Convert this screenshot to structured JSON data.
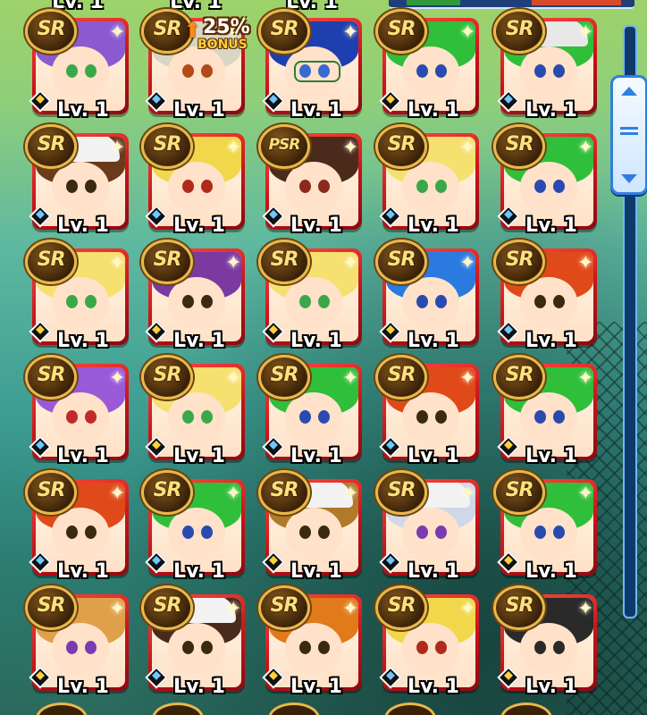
{
  "top_partial_labels": [
    "Lv. 1",
    "Lv. 1",
    "Lv. 1"
  ],
  "bonus": {
    "arrow": "⬆",
    "percent": "25%",
    "label": "BONUS"
  },
  "cards": [
    {
      "rarity": "SR",
      "level": "Lv. 1",
      "hair": "#8b5ad0",
      "eyes": "#3aa84a",
      "marker": "gold",
      "hat": null
    },
    {
      "rarity": "SR",
      "level": "Lv. 1",
      "hair": "#d8d6c4",
      "eyes": "#b24a1a",
      "marker": "blue",
      "hat": null
    },
    {
      "rarity": "SR",
      "level": "Lv. 1",
      "hair": "#1e3fb0",
      "eyes": "#3a6ad0",
      "marker": "blue",
      "hat": null,
      "glasses": true
    },
    {
      "rarity": "SR",
      "level": "Lv. 1",
      "hair": "#2fbf3a",
      "eyes": "#2a4ab0",
      "marker": "gold",
      "hat": null
    },
    {
      "rarity": "SR",
      "level": "Lv. 1",
      "hair": "#2fbf3a",
      "eyes": "#2a4ab0",
      "marker": "blue",
      "hat": "#e8e8e8"
    },
    {
      "rarity": "SR",
      "level": "Lv. 1",
      "hair": "#6a3a1a",
      "eyes": "#3a2a10",
      "marker": "blue",
      "hat": "#f2f2f2"
    },
    {
      "rarity": "SR",
      "level": "Lv. 1",
      "hair": "#f0d84a",
      "eyes": "#b02a1a",
      "marker": "blue",
      "hat": null
    },
    {
      "rarity": "PSR",
      "level": "Lv. 1",
      "hair": "#4a2a1a",
      "eyes": "#8a2a1a",
      "marker": "blue",
      "hat": null
    },
    {
      "rarity": "SR",
      "level": "Lv. 1",
      "hair": "#f6e070",
      "eyes": "#3aa84a",
      "marker": "blue",
      "hat": null
    },
    {
      "rarity": "SR",
      "level": "Lv. 1",
      "hair": "#2fbf3a",
      "eyes": "#2a4ab0",
      "marker": "blue",
      "hat": null
    },
    {
      "rarity": "SR",
      "level": "Lv. 1",
      "hair": "#f6e070",
      "eyes": "#3aa84a",
      "marker": "gold",
      "hat": null
    },
    {
      "rarity": "SR",
      "level": "Lv. 1",
      "hair": "#7a3aa0",
      "eyes": "#3a2a10",
      "marker": "gold",
      "hat": null
    },
    {
      "rarity": "SR",
      "level": "Lv. 1",
      "hair": "#f6e070",
      "eyes": "#3aa84a",
      "marker": "gold",
      "hat": null
    },
    {
      "rarity": "SR",
      "level": "Lv. 1",
      "hair": "#2a7ae0",
      "eyes": "#2a4ab0",
      "marker": "gold",
      "hat": null
    },
    {
      "rarity": "SR",
      "level": "Lv. 1",
      "hair": "#e04a1a",
      "eyes": "#3a2a10",
      "marker": "blue",
      "hat": null
    },
    {
      "rarity": "SR",
      "level": "Lv. 1",
      "hair": "#9a5ad8",
      "eyes": "#c02a2a",
      "marker": "blue",
      "hat": null
    },
    {
      "rarity": "SR",
      "level": "Lv. 1",
      "hair": "#f6e070",
      "eyes": "#3aa84a",
      "marker": "gold",
      "hat": null
    },
    {
      "rarity": "SR",
      "level": "Lv. 1",
      "hair": "#2fbf3a",
      "eyes": "#2a4ab0",
      "marker": "blue",
      "hat": null
    },
    {
      "rarity": "SR",
      "level": "Lv. 1",
      "hair": "#e04a1a",
      "eyes": "#3a2a10",
      "marker": "blue",
      "hat": null
    },
    {
      "rarity": "SR",
      "level": "Lv. 1",
      "hair": "#2fbf3a",
      "eyes": "#2a4ab0",
      "marker": "gold",
      "hat": null
    },
    {
      "rarity": "SR",
      "level": "Lv. 1",
      "hair": "#e04a1a",
      "eyes": "#3a2a10",
      "marker": "blue",
      "hat": null
    },
    {
      "rarity": "SR",
      "level": "Lv. 1",
      "hair": "#2fbf3a",
      "eyes": "#2a4ab0",
      "marker": "blue",
      "hat": null
    },
    {
      "rarity": "SR",
      "level": "Lv. 1",
      "hair": "#b07a2a",
      "eyes": "#3a2a10",
      "marker": "gold",
      "hat": "#f2f2f2"
    },
    {
      "rarity": "SR",
      "level": "Lv. 1",
      "hair": "#d0d8e8",
      "eyes": "#7a3ab0",
      "marker": "blue",
      "hat": "#f2f2f2"
    },
    {
      "rarity": "SR",
      "level": "Lv. 1",
      "hair": "#2fbf3a",
      "eyes": "#2a4ab0",
      "marker": "gold",
      "hat": null
    },
    {
      "rarity": "SR",
      "level": "Lv. 1",
      "hair": "#e0a04a",
      "eyes": "#7a3ab0",
      "marker": "gold",
      "hat": null
    },
    {
      "rarity": "SR",
      "level": "Lv. 1",
      "hair": "#4a2a1a",
      "eyes": "#3a2a10",
      "marker": "blue",
      "hat": "#f2f2f2"
    },
    {
      "rarity": "SR",
      "level": "Lv. 1",
      "hair": "#e07a1a",
      "eyes": "#3a2a10",
      "marker": "gold",
      "hat": null
    },
    {
      "rarity": "SR",
      "level": "Lv. 1",
      "hair": "#f0d84a",
      "eyes": "#b02a1a",
      "marker": "blue",
      "hat": null
    },
    {
      "rarity": "SR",
      "level": "Lv. 1",
      "hair": "#2a2a2a",
      "eyes": "#2a2a2a",
      "marker": "gold",
      "hat": null
    }
  ]
}
